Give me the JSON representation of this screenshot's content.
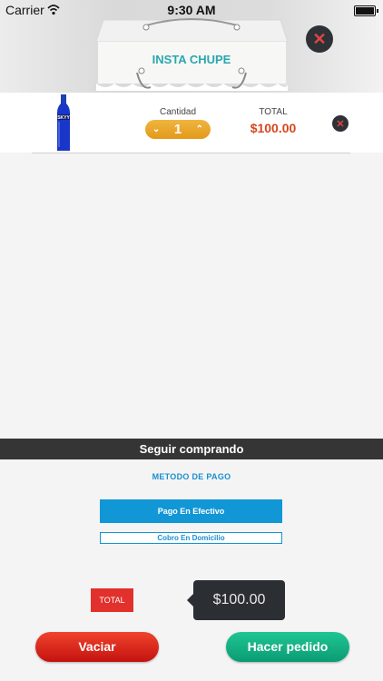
{
  "status_bar": {
    "carrier": "Carrier",
    "time": "9:30 AM"
  },
  "header": {
    "logo_text": "INSTA CHUPE",
    "close_icon": "close-x-icon"
  },
  "cart_item": {
    "quantity_label": "Cantidad",
    "quantity": "1",
    "total_label": "TOTAL",
    "total": "$100.00",
    "bottle_label": "SKYY"
  },
  "continue_label": "Seguir comprando",
  "payment": {
    "title": "METODO DE PAGO",
    "option_cash": "Pago En Efectivo",
    "option_home": "Cobro En Domicilio"
  },
  "summary": {
    "total_label": "TOTAL",
    "total_value": "$100.00"
  },
  "actions": {
    "clear_label": "Vaciar",
    "order_label": "Hacer pedido"
  },
  "colors": {
    "accent_blue": "#1196d6",
    "price_orange": "#d6461d",
    "stepper_orange": "#e39a19",
    "red": "#e2302c",
    "green": "#0a9c72"
  }
}
